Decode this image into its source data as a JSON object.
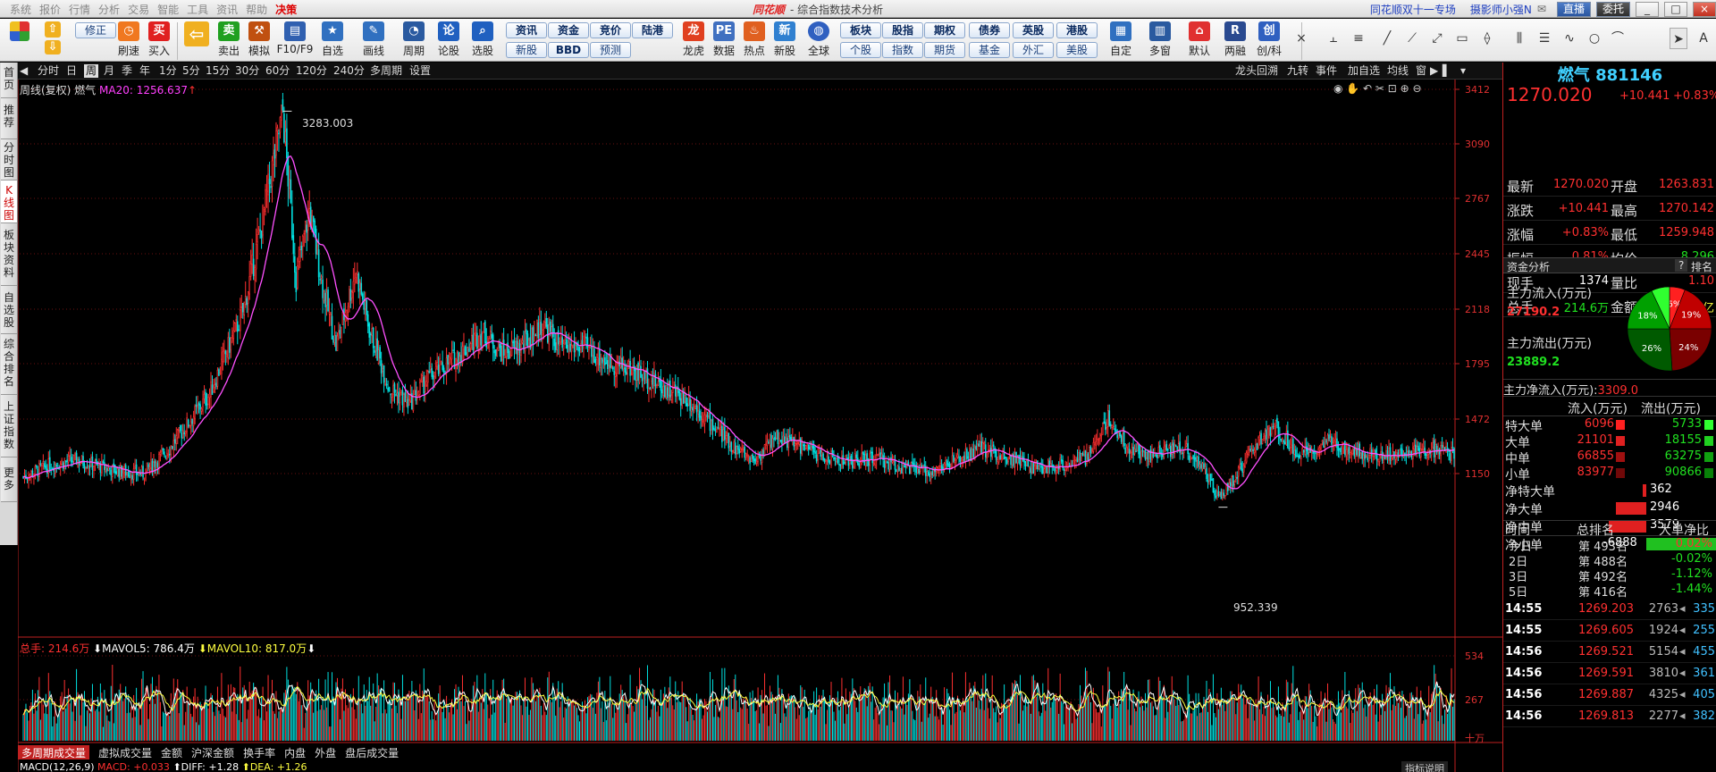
{
  "titlebar": {
    "menu": [
      "系统",
      "报价",
      "行情",
      "分析",
      "交易",
      "智能",
      "工具",
      "资讯",
      "帮助",
      "决策"
    ],
    "brand": "同花顺",
    "title": "- 综合指数技术分析",
    "promo": "同花顺双十一专场",
    "user": "摄影师小强N",
    "btn1": "直播",
    "btn2": "委托",
    "min": "_",
    "max": "□",
    "close": "×"
  },
  "toolbar": {
    "items": [
      "刷速",
      "买入",
      "",
      "卖出",
      "模拟",
      "F10/F9",
      "自选",
      "画线",
      "周期",
      "论股",
      "选股",
      "龙虎",
      "数据",
      "热点",
      "新股",
      "全球",
      "自定",
      "多窗",
      "默认",
      "两融",
      "创/科"
    ],
    "edit": "修正",
    "pills_top": [
      "资讯",
      "资金",
      "竞价",
      "陆港",
      "板块",
      "股指",
      "期权",
      "债券",
      "英股",
      "港股"
    ],
    "pills_bottom": [
      "新股",
      "BBD",
      "预测",
      "",
      "个股",
      "指数",
      "期货",
      "基金",
      "外汇",
      "美股"
    ]
  },
  "left_tabs": [
    "首页",
    "推荐",
    "分时图",
    "K线图",
    "板块资料",
    "自选股",
    "综合排名",
    "上证指数",
    "更多"
  ],
  "period_bar": {
    "periods": [
      "分时",
      "日",
      "周",
      "月",
      "季",
      "年",
      "1分",
      "5分",
      "15分",
      "30分",
      "60分",
      "120分",
      "240分",
      "多周期",
      "设置"
    ],
    "active": "周",
    "right": [
      "龙头回溯",
      "九转",
      "事件",
      "加自选",
      "均线",
      "窗"
    ]
  },
  "kline": {
    "header_name": "周线(复权) 燃气",
    "ma_label": "MA20: 1256.637",
    "high_label": "3283.003",
    "low_label": "952.339",
    "y_labels": [
      "3412",
      "3090",
      "2767",
      "2445",
      "2118",
      "1795",
      "1472",
      "1150"
    ],
    "y_values": [
      3412,
      3090,
      2767,
      2445,
      2118,
      1795,
      1472,
      1150
    ]
  },
  "volume": {
    "header_total": "总手: 214.6万",
    "mavol5": "MAVOL5: 786.4万",
    "mavol10": "MAVOL10: 817.0万",
    "y_labels": [
      "534",
      "267",
      "十万"
    ]
  },
  "bottom_tabs": [
    "多周期成交量",
    "虚拟成交量",
    "金额",
    "沪深金额",
    "换手率",
    "内盘",
    "外盘",
    "盘后成交量"
  ],
  "macd": {
    "label": "MACD(12,26,9)",
    "macd_val": "MACD: +0.033",
    "diff": "DIFF: +1.28",
    "dea": "DEA: +1.26",
    "help": "指标说明"
  },
  "quote": {
    "name": "燃气",
    "code": "881146",
    "price": "1270.020",
    "change": "+10.441",
    "pct": "+0.83%",
    "rows": [
      {
        "k1": "最新",
        "v1": "1270.020",
        "k2": "开盘",
        "v2": "1263.831"
      },
      {
        "k1": "涨跌",
        "v1": "+10.441",
        "k2": "最高",
        "v2": "1270.142"
      },
      {
        "k1": "涨幅",
        "v1": "+0.83%",
        "k2": "最低",
        "v2": "1259.948"
      },
      {
        "k1": "振幅",
        "v1": "0.81%",
        "k2": "均价",
        "v2": "8.296"
      },
      {
        "k1": "现手",
        "v1": "1374",
        "k2": "量比",
        "v2": "1.10"
      },
      {
        "k1": "总手",
        "v1": "214.6万",
        "k2": "金额",
        "v2": "17.80亿"
      }
    ]
  },
  "capital": {
    "title": "资金分析",
    "help": "?",
    "rank": "排名",
    "in_label": "主力流入(万元)",
    "in_value": "27190.2",
    "out_label": "主力流出(万元)",
    "out_value": "23889.2",
    "net_label": "主力净流入(万元):",
    "net_value": "3309.0",
    "pie": [
      {
        "label": "6%",
        "value": 6,
        "color": "#ff2020"
      },
      {
        "label": "19%",
        "value": 19,
        "color": "#c00000"
      },
      {
        "label": "24%",
        "value": 24,
        "color": "#7a0000"
      },
      {
        "label": "26%",
        "value": 26,
        "color": "#005a00"
      },
      {
        "label": "18%",
        "value": 18,
        "color": "#00a000"
      },
      {
        "label": "",
        "value": 7,
        "color": "#30ff30"
      }
    ],
    "col_in": "流入(万元)",
    "col_out": "流出(万元)",
    "flows": [
      {
        "k": "特大单",
        "in": "6096",
        "out": "5733"
      },
      {
        "k": "大单",
        "in": "21101",
        "out": "18155"
      },
      {
        "k": "中单",
        "in": "66855",
        "out": "63275"
      },
      {
        "k": "小单",
        "in": "83977",
        "out": "90866"
      }
    ],
    "nets": [
      {
        "k": "净特大单",
        "v": "362",
        "sign": 1,
        "frac": 0.05
      },
      {
        "k": "净大单",
        "v": "2946",
        "sign": 1,
        "frac": 0.43
      },
      {
        "k": "净中单",
        "v": "3579",
        "sign": 1,
        "frac": 0.52
      },
      {
        "k": "净小单",
        "v": "-6888",
        "sign": -1,
        "frac": 1.0
      }
    ],
    "rank_head": [
      "时间",
      "总排名",
      "大单净比"
    ],
    "ranks": [
      {
        "t": "今日",
        "r": "第 493名",
        "p": "0.02%",
        "c": "red"
      },
      {
        "t": "2日",
        "r": "第 488名",
        "p": "-0.02%",
        "c": "green"
      },
      {
        "t": "3日",
        "r": "第 492名",
        "p": "-1.12%",
        "c": "green"
      },
      {
        "t": "5日",
        "r": "第 416名",
        "p": "-1.44%",
        "c": "green"
      }
    ]
  },
  "ticks": [
    {
      "t": "14:55",
      "p": "1269.203",
      "v": "2763",
      "n": "335"
    },
    {
      "t": "14:55",
      "p": "1269.605",
      "v": "1924",
      "n": "255"
    },
    {
      "t": "14:56",
      "p": "1269.521",
      "v": "5154",
      "n": "455"
    },
    {
      "t": "14:56",
      "p": "1269.591",
      "v": "3810",
      "n": "361"
    },
    {
      "t": "14:56",
      "p": "1269.887",
      "v": "4325",
      "n": "405"
    },
    {
      "t": "14:56",
      "p": "1269.813",
      "v": "2277",
      "n": "382"
    }
  ]
}
